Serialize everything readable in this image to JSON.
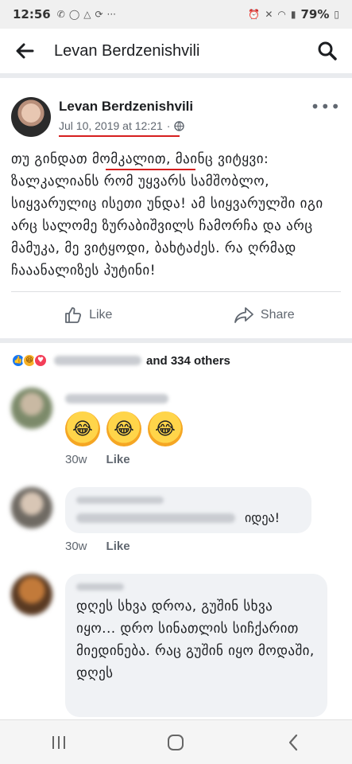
{
  "status": {
    "time": "12:56",
    "battery": "79%",
    "left_icons": [
      "viber-icon",
      "whatsapp-icon",
      "drive-icon",
      "sync-icon"
    ],
    "more": "···"
  },
  "header": {
    "title": "Levan Berdzenishvili"
  },
  "post": {
    "author": "Levan Berdzenishvili",
    "date": "Jul 10, 2019 at 12:21",
    "separator": "·",
    "audience_icon": "globe-icon",
    "text": "თუ გინდათ მომკალით, მაინც ვიტყვი: ზალკალიანს რომ უყვარს სამშობლო, სიყვარულიც ისეთი უნდა! ამ სიყვარულში იგი არც სალომე ზურაბიშვილს ჩამორჩა და არც მამუკა, მე ვიტყოდი, ბახტაძეს. რა ღრმად ჩააანალიზეს პუტინი!",
    "actions": {
      "like": "Like",
      "share": "Share"
    }
  },
  "reactions": {
    "icons": [
      "like",
      "haha",
      "love"
    ],
    "others": "and 334 others"
  },
  "comments": [
    {
      "emojis": [
        "😂",
        "😂",
        "😂"
      ],
      "time": "30w",
      "like": "Like"
    },
    {
      "text": "იდეა!",
      "time": "30w",
      "like": "Like"
    },
    {
      "text": "დღეს სხვა დროა, გუშინ სხვა იყო... დრო სინათლის სიჩქარით მიედინება. რაც გუშინ იყო მოდაში, დღეს"
    }
  ],
  "colors": {
    "accent": "#1877f2",
    "underline": "#d61f1f",
    "secondary_text": "#606770"
  }
}
